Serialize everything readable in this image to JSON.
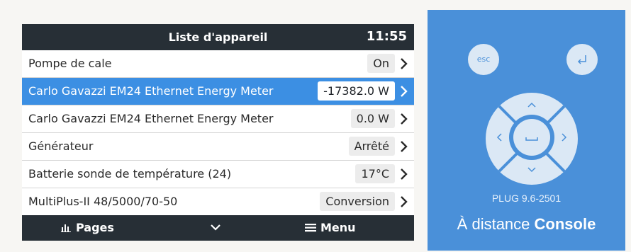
{
  "header": {
    "title": "Liste d'appareil",
    "time": "11:55"
  },
  "rows": [
    {
      "label": "Pompe de cale",
      "value": "On"
    },
    {
      "label": "Carlo Gavazzi EM24 Ethernet Energy Meter",
      "value": "-17382.0 W"
    },
    {
      "label": "Carlo Gavazzi EM24 Ethernet Energy Meter",
      "value": "0.0 W"
    },
    {
      "label": "Générateur",
      "value": "Arrêté"
    },
    {
      "label": "Batterie sonde de température (24)",
      "value": "17°C"
    },
    {
      "label": "MultiPlus-II 48/5000/70-50",
      "value": "Conversion"
    }
  ],
  "selected_row": 1,
  "footer": {
    "pages_label": "Pages",
    "menu_label": "Menu"
  },
  "remote": {
    "esc_label": "esc",
    "device_id": "PLUG 9.6-2501",
    "label_prefix": "À distance",
    "label_strong": "Console"
  },
  "colors": {
    "bar": "#272f36",
    "selected": "#3c8fe3",
    "panel": "#4a90d9",
    "button": "#dbe8f5"
  }
}
